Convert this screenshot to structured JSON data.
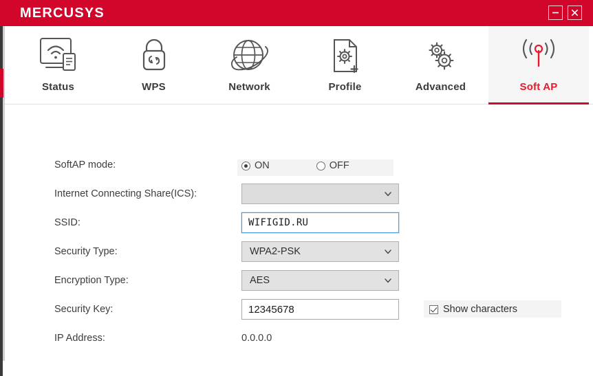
{
  "window": {
    "logo": "MERCUSYS",
    "buttons": [
      {
        "name": "minimize",
        "icon": "minimize-icon"
      },
      {
        "name": "close",
        "icon": "close-icon"
      }
    ]
  },
  "colors": {
    "brand_red": "#d2062b",
    "accent_red": "#e8192c",
    "active_tab_bg": "#f5f5f5",
    "focus_blue": "#4a9ede"
  },
  "tabs": [
    {
      "label": "Status",
      "icon": "monitor-wifi-icon",
      "active": false
    },
    {
      "label": "WPS",
      "icon": "lock-wps-icon",
      "active": false
    },
    {
      "label": "Network",
      "icon": "globe-icon",
      "active": false
    },
    {
      "label": "Profile",
      "icon": "document-gear-plus-icon",
      "active": false
    },
    {
      "label": "Advanced",
      "icon": "gears-icon",
      "active": false
    },
    {
      "label": "Soft AP",
      "icon": "antenna-signal-icon",
      "active": true
    }
  ],
  "form": {
    "softap_mode": {
      "label": "SoftAP mode:",
      "options": [
        {
          "label": "ON",
          "selected": true
        },
        {
          "label": "OFF",
          "selected": false
        }
      ]
    },
    "ics": {
      "label": "Internet Connecting Share(ICS):",
      "value": "",
      "placeholder": ""
    },
    "ssid": {
      "label": "SSID:",
      "value": "WIFIGID.RU"
    },
    "security_type": {
      "label": "Security Type:",
      "value": "WPA2-PSK"
    },
    "encryption_type": {
      "label": "Encryption Type:",
      "value": "AES"
    },
    "security_key": {
      "label": "Security Key:",
      "value": "12345678"
    },
    "show_characters": {
      "label": "Show characters",
      "checked": true
    },
    "ip_address": {
      "label": "IP Address:",
      "value": "0.0.0.0"
    }
  }
}
